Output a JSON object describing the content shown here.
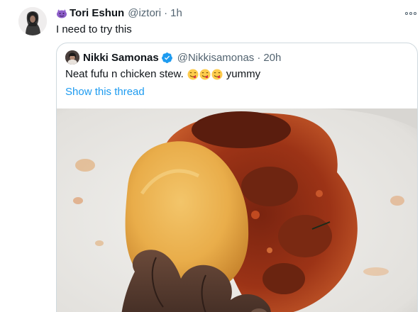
{
  "tweet": {
    "display_name": "Tori Eshun",
    "handle": "@iztori",
    "separator": "·",
    "time": "1h",
    "text": "I need to try this",
    "name_emoji_icon": "purple-monster-emoji-icon",
    "more_icon": "more-options-icon"
  },
  "quoted": {
    "display_name": "Nikki Samonas",
    "verified_icon": "verified-badge-icon",
    "handle": "@Nikkisamonas",
    "separator": "·",
    "time": "20h",
    "text_before": "Neat fufu n chicken stew.",
    "emojis": [
      "yum-emoji-icon",
      "yum-emoji-icon",
      "yum-emoji-icon"
    ],
    "text_after": "yummy",
    "show_thread": "Show this thread",
    "photo_alt": "plate of fufu and chicken stew held by hand"
  },
  "colors": {
    "link": "#1d9bf0",
    "secondary_text": "#536471",
    "border": "#cfd9de",
    "verified": "#1d9bf0"
  }
}
